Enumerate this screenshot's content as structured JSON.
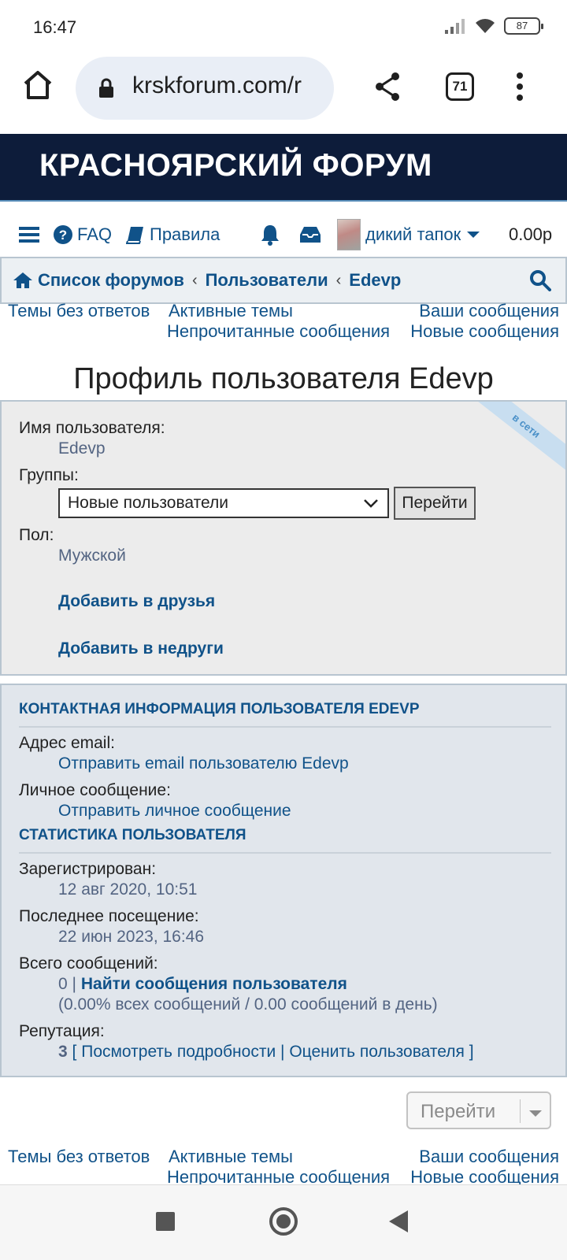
{
  "status": {
    "time": "16:47",
    "battery": "87"
  },
  "browser": {
    "url": "krskforum.com/r",
    "tab_count": "71"
  },
  "forum": {
    "title": "КРАСНОЯРСКИЙ ФОРУМ"
  },
  "nav": {
    "faq": "FAQ",
    "rules": "Правила",
    "username": "дикий тапок",
    "balance": "0.00р"
  },
  "breadcrumb": {
    "items": [
      "Список форумов",
      "Пользователи",
      "Edevp"
    ],
    "separator": "‹"
  },
  "quicklinks": {
    "unanswered": "Темы без ответов",
    "active": "Активные темы",
    "your_posts": "Ваши сообщения",
    "unread": "Непрочитанные сообщения",
    "new": "Новые сообщения"
  },
  "profile": {
    "page_title": "Профиль пользователя Edevp",
    "online_badge": "в сети",
    "username_label": "Имя пользователя:",
    "username_value": "Edevp",
    "groups_label": "Группы:",
    "groups_selected": "Новые пользователи",
    "go_button": "Перейти",
    "gender_label": "Пол:",
    "gender_value": "Мужской",
    "add_friend": "Добавить в друзья",
    "add_foe": "Добавить в недруги"
  },
  "contact": {
    "heading": "КОНТАКТНАЯ ИНФОРМАЦИЯ ПОЛЬЗОВАТЕЛЯ EDEVP",
    "email_label": "Адрес email:",
    "email_link": "Отправить email пользователю Edevp",
    "pm_label": "Личное сообщение:",
    "pm_link": "Отправить личное сообщение"
  },
  "stats": {
    "heading": "СТАТИСТИКА ПОЛЬЗОВАТЕЛЯ",
    "registered_label": "Зарегистрирован:",
    "registered_value": "12 авг 2020, 10:51",
    "last_visit_label": "Последнее посещение:",
    "last_visit_value": "22 июн 2023, 16:46",
    "posts_label": "Всего сообщений:",
    "posts_count": "0",
    "posts_sep": "|",
    "find_posts": "Найти сообщения пользователя",
    "posts_detail": "(0.00% всех сообщений / 0.00 сообщений в день)",
    "reputation_label": "Репутация:",
    "reputation_value": "3",
    "rep_open": "[",
    "rep_details": "Посмотреть подробности",
    "rep_sep": "|",
    "rep_rate": "Оценить пользователя",
    "rep_close": "]"
  },
  "jump": {
    "label": "Перейти"
  },
  "colors": {
    "header_bg": "#0d1c3a",
    "link": "#105289",
    "panel_bg": "#ececec"
  }
}
